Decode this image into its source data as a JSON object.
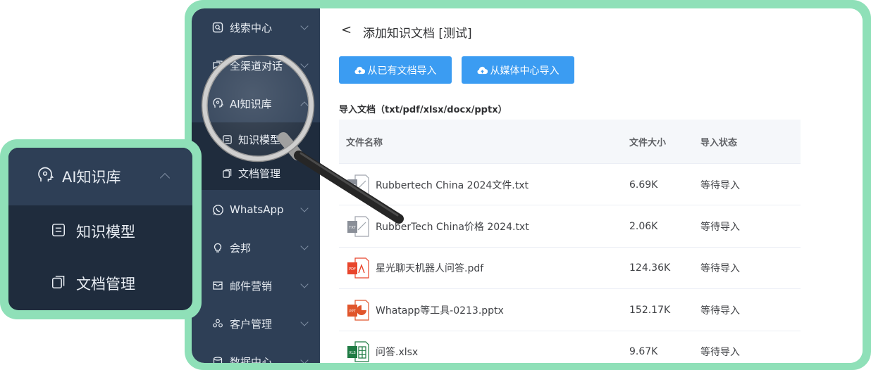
{
  "sidebar": {
    "items": [
      {
        "label": "线索中心",
        "icon": "clue-icon"
      },
      {
        "label": "全渠道对话",
        "icon": "chat-icon"
      },
      {
        "label": "AI知识库",
        "icon": "ai-brain-icon"
      },
      {
        "label": "WhatsApp",
        "icon": "whatsapp-icon"
      },
      {
        "label": "会邦",
        "icon": "bulb-icon"
      },
      {
        "label": "邮件营销",
        "icon": "mail-icon"
      },
      {
        "label": "客户管理",
        "icon": "customers-icon"
      },
      {
        "label": "数据中心",
        "icon": "data-icon"
      }
    ],
    "subitems": [
      {
        "label": "知识模型",
        "icon": "model-icon"
      },
      {
        "label": "文档管理",
        "icon": "document-icon"
      }
    ]
  },
  "page": {
    "back_symbol": "<",
    "title": "添加知识文档 [测试]",
    "buttons": [
      {
        "label": "从已有文档导入",
        "icon": "cloud-upload-icon"
      },
      {
        "label": "从媒体中心导入",
        "icon": "cloud-upload-icon"
      }
    ],
    "section_title": "导入文档（txt/pdf/xlsx/docx/pptx）"
  },
  "table": {
    "headers": [
      "文件名称",
      "文件大小",
      "导入状态"
    ],
    "rows": [
      {
        "name": "Rubbertech China 2024文件.txt",
        "size": "6.69K",
        "status": "等待导入",
        "type": "txt"
      },
      {
        "name": "RubberTech China价格 2024.txt",
        "size": "2.06K",
        "status": "等待导入",
        "type": "txt"
      },
      {
        "name": "星光聊天机器人问答.pdf",
        "size": "124.36K",
        "status": "等待导入",
        "type": "pdf"
      },
      {
        "name": "Whatapp等工具-0213.pptx",
        "size": "152.17K",
        "status": "等待导入",
        "type": "pptx"
      },
      {
        "name": "问答.xlsx",
        "size": "9.67K",
        "status": "等待导入",
        "type": "xlsx"
      }
    ]
  },
  "zoom": {
    "header": "AI知识库",
    "items": [
      "知识模型",
      "文档管理"
    ]
  },
  "file_badges": {
    "txt": "TXT",
    "pdf": "PDF",
    "pptx": "PPT",
    "xlsx": "XLS"
  },
  "colors": {
    "accent": "#3b9cf2",
    "sidebar": "#2e3f56",
    "sidebar_active": "#1f2c3d",
    "frame": "#8fe0b8",
    "pdf": "#e8452c",
    "ppt": "#e0552b",
    "xls": "#1f7b44",
    "txt": "#8a8f98"
  }
}
